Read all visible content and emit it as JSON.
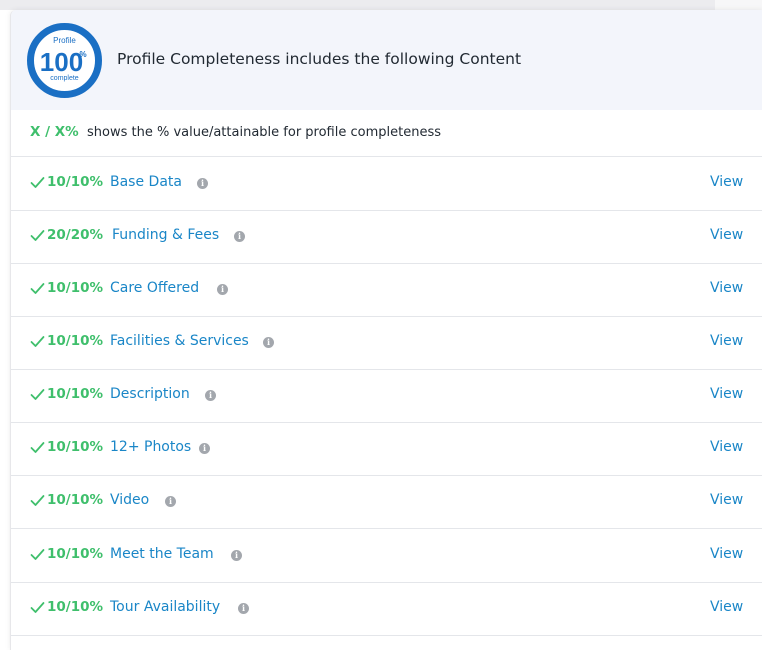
{
  "badge": {
    "top_text": "Profile",
    "value": "100",
    "unit": "%",
    "bottom_text": "complete",
    "ring_color": "#1a6fc4"
  },
  "header": {
    "title": "Profile Completeness includes the following Content"
  },
  "legend": {
    "key": "X / X%",
    "text": "shows the % value/attainable for profile completeness"
  },
  "colors": {
    "success": "#3fbf6c",
    "link": "#1a86c7",
    "header_bg": "#f3f5fb"
  },
  "rows": [
    {
      "score": "10/10%",
      "label": "Base Data",
      "action": "View",
      "icon": "check-icon"
    },
    {
      "score": "20/20%",
      "label": "Funding & Fees",
      "action": "View",
      "icon": "check-icon"
    },
    {
      "score": "10/10%",
      "label": "Care Offered",
      "action": "View",
      "icon": "check-icon"
    },
    {
      "score": "10/10%",
      "label": "Facilities & Services",
      "action": "View",
      "icon": "check-icon"
    },
    {
      "score": "10/10%",
      "label": "Description",
      "action": "View",
      "icon": "check-icon"
    },
    {
      "score": "10/10%",
      "label": "12+ Photos",
      "action": "View",
      "icon": "check-icon"
    },
    {
      "score": "10/10%",
      "label": "Video",
      "action": "View",
      "icon": "check-icon"
    },
    {
      "score": "10/10%",
      "label": "Meet the Team",
      "action": "View",
      "icon": "check-icon"
    },
    {
      "score": "10/10%",
      "label": "Tour Availability",
      "action": "View",
      "icon": "check-icon"
    }
  ]
}
